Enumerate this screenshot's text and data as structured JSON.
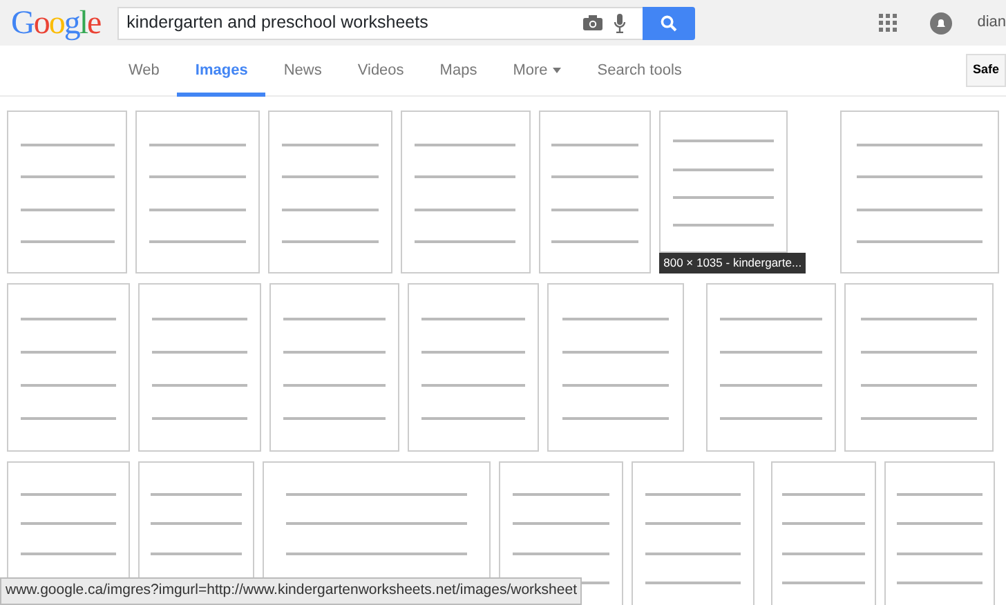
{
  "logo": "Google",
  "search": {
    "value": "kindergarten and preschool worksheets"
  },
  "account": {
    "name": "dian"
  },
  "tabs": [
    {
      "label": "Web",
      "selected": false
    },
    {
      "label": "Images",
      "selected": true
    },
    {
      "label": "News",
      "selected": false
    },
    {
      "label": "Videos",
      "selected": false
    },
    {
      "label": "Maps",
      "selected": false
    },
    {
      "label": "More",
      "selected": false,
      "kind": "menu"
    },
    {
      "label": "Search tools",
      "selected": false
    }
  ],
  "safesearch_button": "Safe",
  "hover_caption": "800 × 1035 - kindergarte...",
  "status_bar": "www.google.ca/imgres?imgurl=http://www.kindergartenworksheets.net/images/worksheet"
}
